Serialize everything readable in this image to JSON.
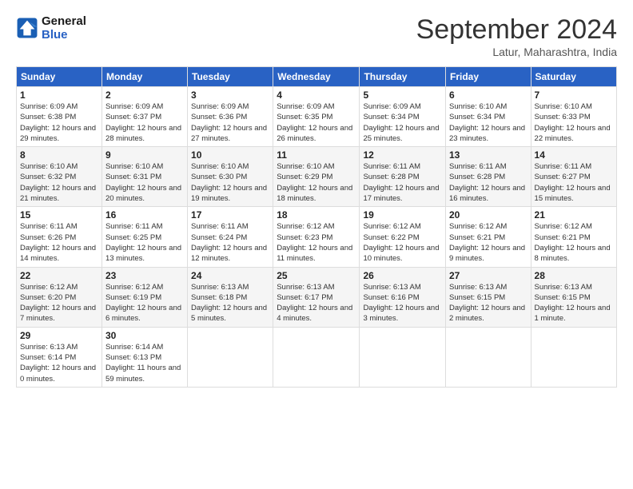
{
  "logo": {
    "line1": "General",
    "line2": "Blue"
  },
  "title": "September 2024",
  "subtitle": "Latur, Maharashtra, India",
  "days_header": [
    "Sunday",
    "Monday",
    "Tuesday",
    "Wednesday",
    "Thursday",
    "Friday",
    "Saturday"
  ],
  "weeks": [
    [
      {
        "num": "1",
        "rise": "6:09 AM",
        "set": "6:38 PM",
        "daylight": "12 hours and 29 minutes."
      },
      {
        "num": "2",
        "rise": "6:09 AM",
        "set": "6:37 PM",
        "daylight": "12 hours and 28 minutes."
      },
      {
        "num": "3",
        "rise": "6:09 AM",
        "set": "6:36 PM",
        "daylight": "12 hours and 27 minutes."
      },
      {
        "num": "4",
        "rise": "6:09 AM",
        "set": "6:35 PM",
        "daylight": "12 hours and 26 minutes."
      },
      {
        "num": "5",
        "rise": "6:09 AM",
        "set": "6:34 PM",
        "daylight": "12 hours and 25 minutes."
      },
      {
        "num": "6",
        "rise": "6:10 AM",
        "set": "6:34 PM",
        "daylight": "12 hours and 23 minutes."
      },
      {
        "num": "7",
        "rise": "6:10 AM",
        "set": "6:33 PM",
        "daylight": "12 hours and 22 minutes."
      }
    ],
    [
      {
        "num": "8",
        "rise": "6:10 AM",
        "set": "6:32 PM",
        "daylight": "12 hours and 21 minutes."
      },
      {
        "num": "9",
        "rise": "6:10 AM",
        "set": "6:31 PM",
        "daylight": "12 hours and 20 minutes."
      },
      {
        "num": "10",
        "rise": "6:10 AM",
        "set": "6:30 PM",
        "daylight": "12 hours and 19 minutes."
      },
      {
        "num": "11",
        "rise": "6:10 AM",
        "set": "6:29 PM",
        "daylight": "12 hours and 18 minutes."
      },
      {
        "num": "12",
        "rise": "6:11 AM",
        "set": "6:28 PM",
        "daylight": "12 hours and 17 minutes."
      },
      {
        "num": "13",
        "rise": "6:11 AM",
        "set": "6:28 PM",
        "daylight": "12 hours and 16 minutes."
      },
      {
        "num": "14",
        "rise": "6:11 AM",
        "set": "6:27 PM",
        "daylight": "12 hours and 15 minutes."
      }
    ],
    [
      {
        "num": "15",
        "rise": "6:11 AM",
        "set": "6:26 PM",
        "daylight": "12 hours and 14 minutes."
      },
      {
        "num": "16",
        "rise": "6:11 AM",
        "set": "6:25 PM",
        "daylight": "12 hours and 13 minutes."
      },
      {
        "num": "17",
        "rise": "6:11 AM",
        "set": "6:24 PM",
        "daylight": "12 hours and 12 minutes."
      },
      {
        "num": "18",
        "rise": "6:12 AM",
        "set": "6:23 PM",
        "daylight": "12 hours and 11 minutes."
      },
      {
        "num": "19",
        "rise": "6:12 AM",
        "set": "6:22 PM",
        "daylight": "12 hours and 10 minutes."
      },
      {
        "num": "20",
        "rise": "6:12 AM",
        "set": "6:21 PM",
        "daylight": "12 hours and 9 minutes."
      },
      {
        "num": "21",
        "rise": "6:12 AM",
        "set": "6:21 PM",
        "daylight": "12 hours and 8 minutes."
      }
    ],
    [
      {
        "num": "22",
        "rise": "6:12 AM",
        "set": "6:20 PM",
        "daylight": "12 hours and 7 minutes."
      },
      {
        "num": "23",
        "rise": "6:12 AM",
        "set": "6:19 PM",
        "daylight": "12 hours and 6 minutes."
      },
      {
        "num": "24",
        "rise": "6:13 AM",
        "set": "6:18 PM",
        "daylight": "12 hours and 5 minutes."
      },
      {
        "num": "25",
        "rise": "6:13 AM",
        "set": "6:17 PM",
        "daylight": "12 hours and 4 minutes."
      },
      {
        "num": "26",
        "rise": "6:13 AM",
        "set": "6:16 PM",
        "daylight": "12 hours and 3 minutes."
      },
      {
        "num": "27",
        "rise": "6:13 AM",
        "set": "6:15 PM",
        "daylight": "12 hours and 2 minutes."
      },
      {
        "num": "28",
        "rise": "6:13 AM",
        "set": "6:15 PM",
        "daylight": "12 hours and 1 minute."
      }
    ],
    [
      {
        "num": "29",
        "rise": "6:13 AM",
        "set": "6:14 PM",
        "daylight": "12 hours and 0 minutes."
      },
      {
        "num": "30",
        "rise": "6:14 AM",
        "set": "6:13 PM",
        "daylight": "11 hours and 59 minutes."
      },
      null,
      null,
      null,
      null,
      null
    ]
  ]
}
